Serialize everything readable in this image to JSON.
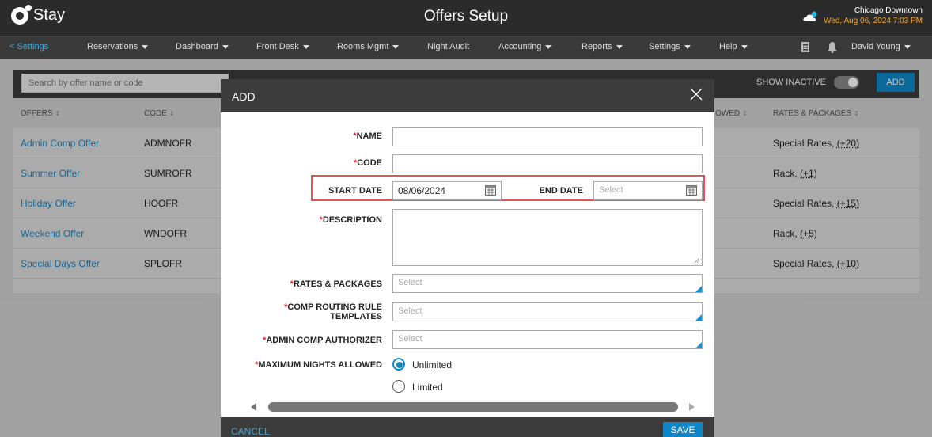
{
  "app": {
    "logo_text": "Stay",
    "title": "Offers Setup"
  },
  "location": {
    "name": "Chicago Downtown",
    "datetime": "Wed, Aug 06, 2024 7:03 PM"
  },
  "nav": {
    "back": "< Settings",
    "items": [
      "Reservations",
      "Dashboard",
      "Front Desk",
      "Rooms Mgmt",
      "Night Audit",
      "Accounting",
      "Reports",
      "Settings",
      "Help"
    ],
    "user": "David Young"
  },
  "toolbar": {
    "search_placeholder": "Search by offer name or code",
    "show_inactive": "SHOW INACTIVE",
    "add": "ADD"
  },
  "table": {
    "headers": [
      "OFFERS",
      "CODE",
      "OWED",
      "RATES & PACKAGES"
    ],
    "rows": [
      {
        "name": "Admin Comp Offer",
        "code": "ADMNOFR",
        "rates": "Special Rates,",
        "more": "(+20)"
      },
      {
        "name": "Summer Offer",
        "code": "SUMROFR",
        "rates": "Rack,",
        "more": "(+1)"
      },
      {
        "name": "Holiday Offer",
        "code": "HOOFR",
        "rates": "Special Rates,",
        "more": "(+15)"
      },
      {
        "name": "Weekend Offer",
        "code": "WNDOFR",
        "rates": "Rack,",
        "more": "(+5)"
      },
      {
        "name": "Special Days Offer",
        "code": "SPLOFR",
        "rates": "Special Rates,",
        "more": "(+10)"
      }
    ]
  },
  "modal": {
    "title": "ADD",
    "name_label": "NAME",
    "code_label": "CODE",
    "start_date_label": "START DATE",
    "start_date_value": "08/06/2024",
    "end_date_label": "END DATE",
    "end_date_placeholder": "Select",
    "description_label": "DESCRIPTION",
    "rates_label": "RATES & PACKAGES",
    "comp_routing_label_1": "COMP ROUTING RULE",
    "comp_routing_label_2": "TEMPLATES",
    "admin_comp_label": "ADMIN COMP AUTHORIZER",
    "max_nights_label": "MAXIMUM NIGHTS ALLOWED",
    "select_placeholder": "Select",
    "opt_unlimited": "Unlimited",
    "opt_limited": "Limited",
    "required_mark": "*",
    "cancel": "CANCEL",
    "save": "SAVE"
  },
  "colors": {
    "accent": "#0e86c7",
    "link": "#1a84c2",
    "required": "#d9252a",
    "highlight": "#e05555",
    "date_orange": "#f0a830"
  }
}
